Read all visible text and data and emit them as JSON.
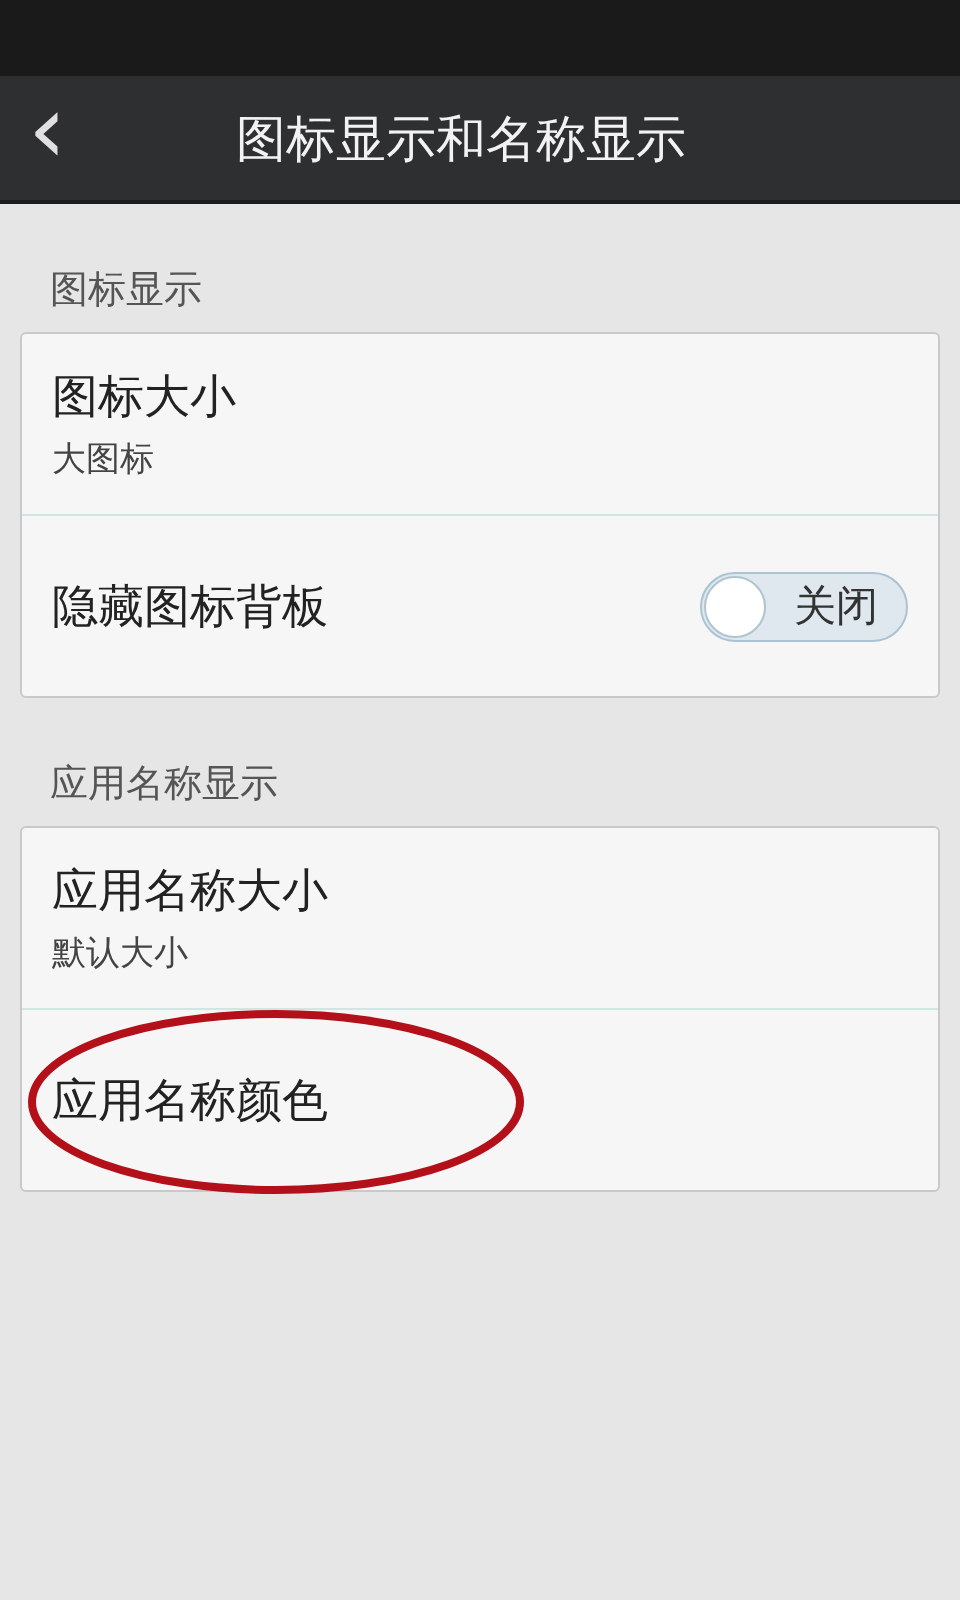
{
  "header": {
    "back": "‹",
    "title": "图标显示和名称显示"
  },
  "sections": [
    {
      "label": "图标显示",
      "rows": [
        {
          "kind": "value",
          "title": "图标大小",
          "subtitle": "大图标",
          "circled": false
        },
        {
          "kind": "toggle",
          "title": "隐藏图标背板",
          "on": false,
          "state_text": "关闭",
          "circled": false
        }
      ]
    },
    {
      "label": "应用名称显示",
      "rows": [
        {
          "kind": "value",
          "title": "应用名称大小",
          "subtitle": "默认大小",
          "circled": false
        },
        {
          "kind": "plain",
          "title": "应用名称颜色",
          "circled": true
        }
      ]
    }
  ]
}
